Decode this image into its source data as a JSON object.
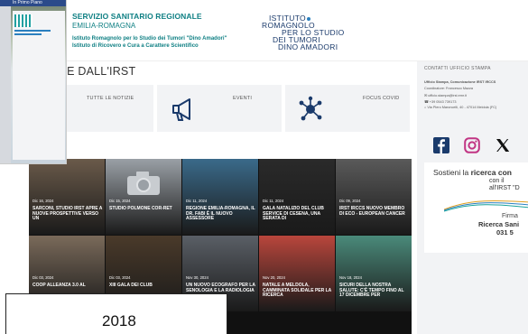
{
  "thumbnail": {
    "title": "In Primo Piano"
  },
  "header": {
    "org_title": "SERVIZIO SANITARIO REGIONALE",
    "org_sub": "EMILIA-ROMAGNA",
    "inst_line1": "Istituto Romagnolo per lo Studio dei Tumori \"Dino Amadori\"",
    "inst_line2": "Istituto di Ricovero e Cura a Carattere Scientifico",
    "logo_lines": [
      "ISTITUTO",
      "ROMAGNOLO",
      "PER LO STUDIO",
      "DEI TUMORI",
      "DINO AMADORI"
    ]
  },
  "news": {
    "title": "NOTIZIE DALL'IRST",
    "quick_links": [
      {
        "label": "TUTTE LE NOTIZIE",
        "icon": "newspaper-icon"
      },
      {
        "label": "EVENTI",
        "icon": "megaphone-icon"
      },
      {
        "label": "FOCUS COVID",
        "icon": "virus-icon"
      }
    ],
    "tiles": [
      {
        "date": "Dic 16, 2024",
        "caption": "SARCONI, STUDIO IRST APRE A NUOVE PROSPETTIVE VERSO UN",
        "bg": "#6a5a4a"
      },
      {
        "date": "Dic 15, 2024",
        "caption": "STUDIO POLMONE COR-RET",
        "bg": "#9aa0a6"
      },
      {
        "date": "Dic 11, 2024",
        "caption": "REGIONE EMILIA-ROMAGNA, IL DR. FABI È IL NUOVO ASSESSORE",
        "bg": "#3a6a8a"
      },
      {
        "date": "Dic 11, 2024",
        "caption": "GALA NATALIZIO DEL CLUB SERVICE DI CESENA, UNA SERATA DI",
        "bg": "#2a2a2a"
      },
      {
        "date": "Dic 09, 2024",
        "caption": "IRST IRCCS NUOVO MEMBRO DI ECO - EUROPEAN CANCER",
        "bg": "#5a5a5a"
      },
      {
        "date": "Dic 03, 2024",
        "caption": "COOP ALLEANZA 3.0 AL",
        "bg": "#7a6a5a"
      },
      {
        "date": "Dic 03, 2024",
        "caption": "XIII GALA DEI CLUB",
        "bg": "#4a3a2a"
      },
      {
        "date": "Nov 30, 2024",
        "caption": "UN NUOVO ECOGRAFO PER LA SENOLOGIA E LA RADIOLOGIA",
        "bg": "#5a5f66"
      },
      {
        "date": "Nov 20, 2024",
        "caption": "NATALE A MELDOLA, CAMMINATA SOLIDALE PER LA RICERCA",
        "bg": "#b9463c"
      },
      {
        "date": "Nov 18, 2024",
        "caption": "SICURI DELLA NOSTRA SALUTE: C'È TEMPO FINO AL 17 DICEMBRE PER",
        "bg": "#4a8a7a"
      }
    ]
  },
  "sidebar": {
    "contact_title": "CONTATTI UFFICIO STAMPA",
    "contact_lines": [
      "Ufficio Stampa, Comunicazione IRST IRCCS",
      "Coordinatore: Francesco Mazza",
      "ufficio.stampa@irst.emr.it",
      "+39 0543 739173",
      "Via Piero Maroncelli, 40 - 47014 Meldola (FC)"
    ],
    "social": [
      "facebook-icon",
      "instagram-icon",
      "x-icon"
    ],
    "promo": {
      "line1a": "Sostieni la ",
      "line1b": "ricerca con",
      "line2": "con il",
      "line3": "all'IRST \"D",
      "line4": "Firma",
      "line5": "Ricerca Sani",
      "line6": "031 5"
    }
  },
  "overlay": {
    "year": "2018"
  },
  "colors": {
    "teal": "#0e7f83",
    "navy": "#1a3a6b",
    "accent_blue": "#2a7fbf"
  }
}
